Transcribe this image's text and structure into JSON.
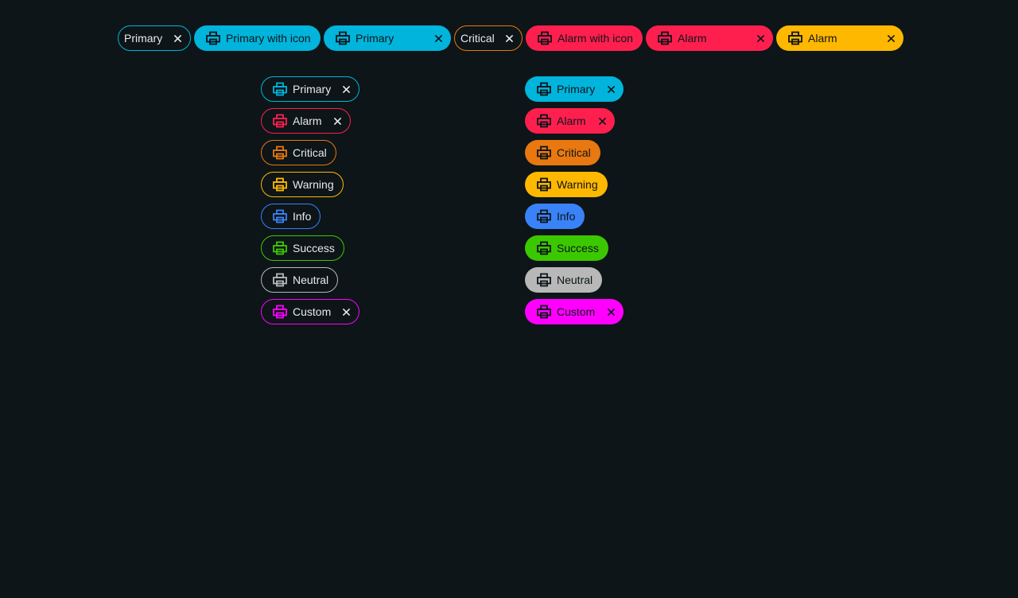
{
  "colors": {
    "background": "#0d1518",
    "primary": "#00b4dc",
    "alarm": "#ff1f4f",
    "critical": "#e8780f",
    "warning": "#ffb800",
    "info": "#3a82f7",
    "success": "#3cc800",
    "neutral": "#b8b8b8",
    "custom": "#ff00ff"
  },
  "top_row": [
    {
      "label": "Primary",
      "style": "outline",
      "color": "primary",
      "icon": null,
      "closable": true
    },
    {
      "label": "Primary with icon",
      "style": "filled",
      "color": "primary",
      "icon": "printer-icon",
      "closable": false
    },
    {
      "label": "Primary",
      "style": "filled",
      "color": "primary",
      "icon": "printer-icon",
      "closable": true
    },
    {
      "label": "Critical",
      "style": "outline",
      "color": "critical",
      "icon": null,
      "closable": true
    },
    {
      "label": "Alarm with icon",
      "style": "filled",
      "color": "alarm",
      "icon": "printer-icon",
      "closable": false
    },
    {
      "label": "Alarm",
      "style": "filled",
      "color": "alarm",
      "icon": "printer-icon",
      "closable": true
    },
    {
      "label": "Alarm",
      "style": "filled",
      "color": "warning",
      "icon": "printer-icon",
      "closable": true
    }
  ],
  "outline_column": [
    {
      "label": "Primary",
      "color": "primary",
      "icon": "printer-icon",
      "closable": true
    },
    {
      "label": "Alarm",
      "color": "alarm",
      "icon": "printer-icon",
      "closable": true
    },
    {
      "label": "Critical",
      "color": "critical",
      "icon": "printer-icon",
      "closable": false
    },
    {
      "label": "Warning",
      "color": "warning",
      "icon": "printer-icon",
      "closable": false
    },
    {
      "label": "Info",
      "color": "info",
      "icon": "printer-icon",
      "closable": false
    },
    {
      "label": "Success",
      "color": "success",
      "icon": "printer-icon",
      "closable": false
    },
    {
      "label": "Neutral",
      "color": "neutral",
      "icon": "printer-icon",
      "closable": false
    },
    {
      "label": "Custom",
      "color": "custom",
      "icon": "printer-icon",
      "closable": true
    }
  ],
  "filled_column": [
    {
      "label": "Primary",
      "color": "primary",
      "icon": "printer-icon",
      "closable": true
    },
    {
      "label": "Alarm",
      "color": "alarm",
      "icon": "printer-icon",
      "closable": true
    },
    {
      "label": "Critical",
      "color": "critical",
      "icon": "printer-icon",
      "closable": false
    },
    {
      "label": "Warning",
      "color": "warning",
      "icon": "printer-icon",
      "closable": false
    },
    {
      "label": "Info",
      "color": "info",
      "icon": "printer-icon",
      "closable": false
    },
    {
      "label": "Success",
      "color": "success",
      "icon": "printer-icon",
      "closable": false
    },
    {
      "label": "Neutral",
      "color": "neutral",
      "icon": "printer-icon",
      "closable": false
    },
    {
      "label": "Custom",
      "color": "custom",
      "icon": "printer-icon",
      "closable": true
    }
  ]
}
